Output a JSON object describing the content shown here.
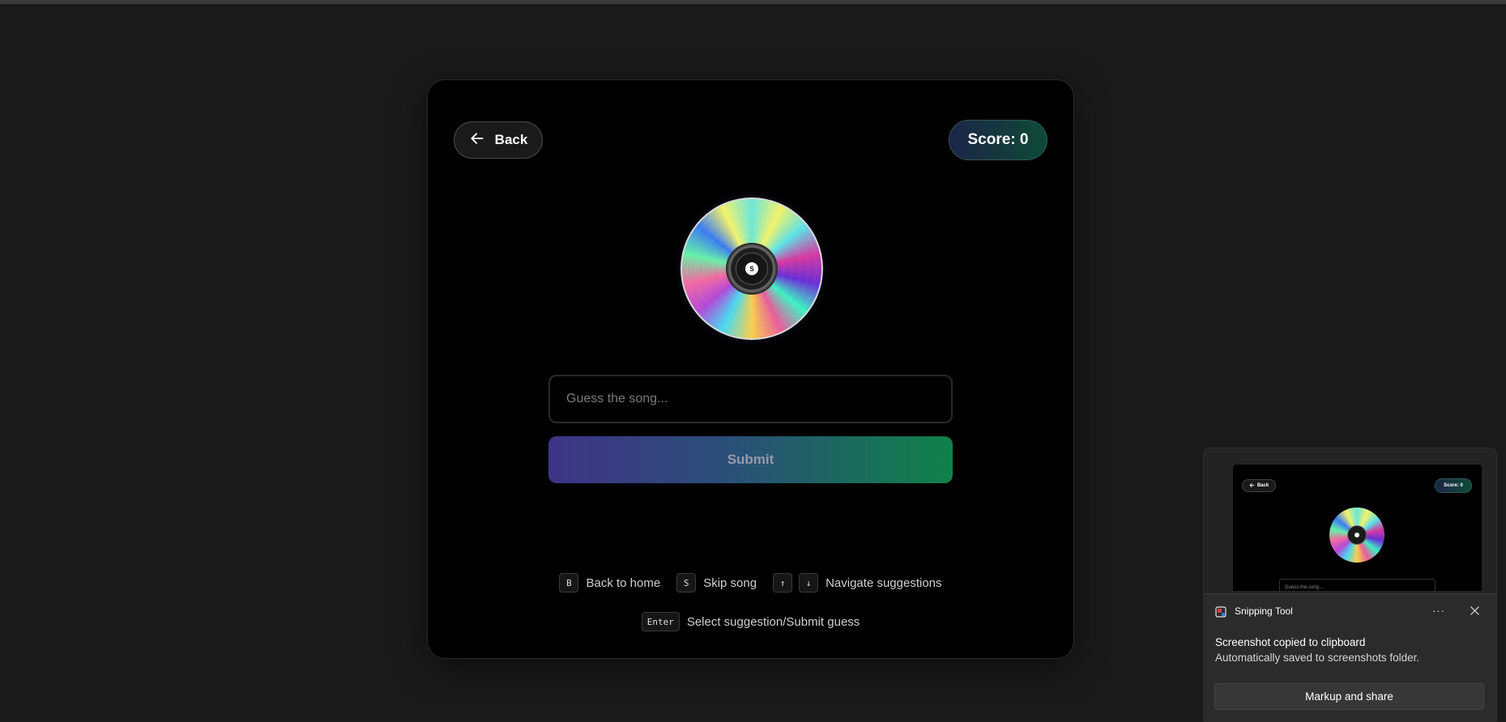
{
  "game": {
    "back_label": "Back",
    "score_label": "Score: 0",
    "disc_label": "S",
    "guess_placeholder": "Guess the song...",
    "guess_value": "",
    "submit_label": "Submit"
  },
  "shortcuts": {
    "back_key": "B",
    "back_desc": "Back to home",
    "skip_key": "S",
    "skip_desc": "Skip song",
    "up_key": "↑",
    "down_key": "↓",
    "nav_desc": "Navigate suggestions",
    "enter_key": "Enter",
    "enter_desc": "Select suggestion/Submit guess"
  },
  "notification": {
    "app_name": "Snipping Tool",
    "more_icon_text": "···",
    "message": "Screenshot copied to clipboard",
    "sub_message": "Automatically saved to screenshots folder.",
    "action_label": "Markup and share",
    "thumb_back": "Back",
    "thumb_score": "Score: 0",
    "thumb_placeholder": "Guess the song..."
  },
  "icons": {
    "back": "arrow-left-icon",
    "disc": "cd-disc-icon",
    "snipping": "snipping-tool-icon",
    "more": "more-horizontal-icon",
    "close": "close-icon"
  },
  "colors": {
    "background": "#1a1a1a",
    "card": "#000000",
    "submit_start": "#3f3486",
    "submit_end": "#0f8148",
    "score_start": "#1c2547",
    "score_end": "#0e4a37"
  }
}
